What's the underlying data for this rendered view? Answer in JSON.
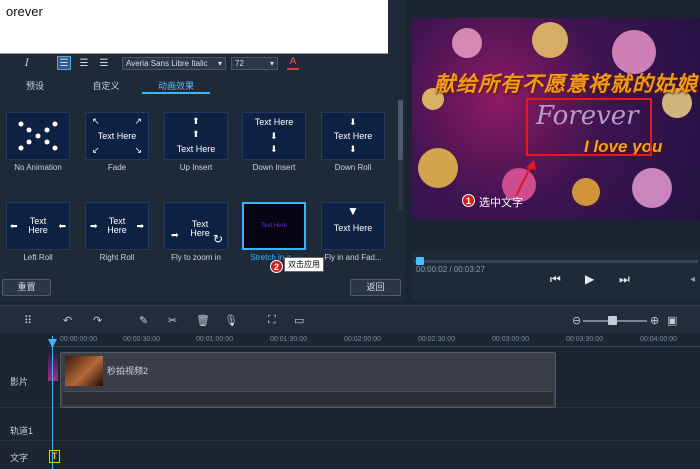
{
  "text_input": {
    "value": "orever"
  },
  "format_toolbar": {
    "italic_glyph": "I",
    "font_name": "Averia Sans Libre Italic",
    "font_size": "72",
    "text_color_glyph": "A"
  },
  "tabs": [
    {
      "label": "预设"
    },
    {
      "label": "自定义"
    },
    {
      "label": "动画效果"
    }
  ],
  "animations": [
    {
      "label": "No Animation",
      "thumb": ""
    },
    {
      "label": "Fade",
      "thumb": "Text Here"
    },
    {
      "label": "Up Insert",
      "thumb": "Text Here"
    },
    {
      "label": "Down Insert",
      "thumb": "Text Here"
    },
    {
      "label": "Down Roll",
      "thumb": "Text Here"
    },
    {
      "label": "Left Roll",
      "thumb": "Text Here"
    },
    {
      "label": "Right Roll",
      "thumb": "Text Here"
    },
    {
      "label": "Fly to zoom in",
      "thumb": "Text Here"
    },
    {
      "label": "Stretch in a...",
      "thumb": "Text Here"
    },
    {
      "label": "Fly in and Fad...",
      "thumb": "Text Here"
    }
  ],
  "buttons": {
    "reset": "重置",
    "back": "返回"
  },
  "annotations": {
    "step1_number": "1",
    "step1_text": "选中文字",
    "step2_number": "2",
    "step2_text": "双击应用"
  },
  "preview": {
    "line1": "献给所有不愿意将就的姑娘",
    "line2": "Forever",
    "line3": "I love you"
  },
  "transport": {
    "timecode": "00:00:02 / 00:03:27"
  },
  "timeline": {
    "ticks": [
      "00:00:00:00",
      "00:00:30:00",
      "00:01:00:00",
      "00:01:30:00",
      "00:02:00:00",
      "00:02:30:00",
      "00:03:00:00",
      "00:03:30:00",
      "00:04:00:00"
    ],
    "tracks": {
      "video": "影片",
      "track1": "轨道1",
      "text": "文字"
    },
    "clip_name": "秒拍视频2",
    "title_clip_glyph": "T"
  },
  "colors": {
    "accent": "#3fb5f5",
    "annotation_red": "#d01e1e",
    "title_orange": "#f29a17"
  }
}
